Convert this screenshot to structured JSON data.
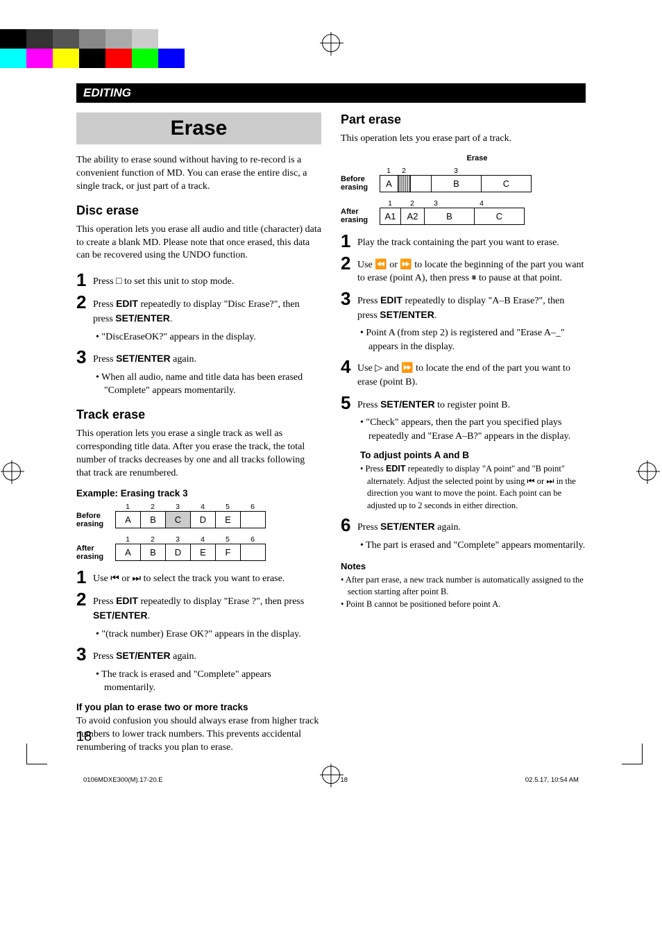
{
  "section_bar": "EDITING",
  "title": "Erase",
  "intro": "The ability to erase sound without having to re-record is a convenient function of MD. You can erase the entire disc, a single track, or just part of a track.",
  "disc_erase": {
    "heading": "Disc erase",
    "intro": "This operation lets you erase all audio and title (character) data to create a blank MD. Please note that once erased, this data can be recovered using the UNDO function.",
    "step1": "Press □ to set this unit to stop mode.",
    "step2_a": "Press ",
    "step2_edit": "EDIT",
    "step2_b": " repeatedly to display \"Disc Erase?\", then press ",
    "step2_set": "SET/ENTER",
    "step2_c": ".",
    "step2_bullet": "\"DiscEraseOK?\" appears in the display.",
    "step3_a": "Press ",
    "step3_set": "SET/ENTER",
    "step3_b": " again.",
    "step3_bullet": "When all audio, name and title data has been erased \"Complete\" appears momentarily."
  },
  "track_erase": {
    "heading": "Track erase",
    "intro": "This operation lets you erase a single track as well as corresponding title data. After you erase the track, the total number of tracks decreases by one and all tracks following that track are renumbered.",
    "example_heading": "Example: Erasing track 3",
    "before_label": "Before erasing",
    "after_label": "After erasing",
    "before_nums": [
      "1",
      "2",
      "3",
      "4",
      "5",
      "6"
    ],
    "before_cells": [
      "A",
      "B",
      "C",
      "D",
      "E",
      ""
    ],
    "after_nums": [
      "1",
      "2",
      "3",
      "4",
      "5",
      "6"
    ],
    "after_cells": [
      "A",
      "B",
      "D",
      "E",
      "F",
      ""
    ],
    "step1": "Use ⏮ or ⏭ to select the track you want to erase.",
    "step2_a": "Press ",
    "step2_edit": "EDIT",
    "step2_b": " repeatedly to display \"Erase ?\", then press ",
    "step2_set": "SET/ENTER",
    "step2_c": ".",
    "step2_bullet": "\"(track number) Erase OK?\" appears in the display.",
    "step3_a": "Press ",
    "step3_set": "SET/ENTER",
    "step3_b": " again.",
    "step3_bullet": "The track is erased and \"Complete\" appears momentarily.",
    "two_or_more_heading": "If you plan to erase two or more tracks",
    "two_or_more_body": "To avoid confusion you should always erase from higher track numbers to lower track numbers. This prevents accidental renumbering of tracks you plan to erase."
  },
  "part_erase": {
    "heading": "Part erase",
    "intro": "This operation lets you erase part of a track.",
    "erase_label": "Erase",
    "before_label": "Before erasing",
    "after_label": "After erasing",
    "before_nums": [
      "1",
      "2",
      "3"
    ],
    "before_cells": [
      "A",
      "B",
      "C"
    ],
    "after_nums": [
      "1",
      "2",
      "3",
      "4"
    ],
    "after_cells": [
      "A1",
      "A2",
      "B",
      "C"
    ],
    "step1": "Play the track containing the part you want to erase.",
    "step2": "Use ⏪ or ⏩ to locate the beginning of the part you want to erase (point A), then press ⏸ to pause at that point.",
    "step3_a": "Press ",
    "step3_edit": "EDIT",
    "step3_b": " repeatedly to display \"A–B Erase?\", then press ",
    "step3_set": "SET/ENTER",
    "step3_c": ".",
    "step3_bullet": "Point A (from step 2) is registered and \"Erase A–_\" appears in the display.",
    "step4": "Use ▷ and ⏩ to locate the end of the part you want to erase (point B).",
    "step5_a": "Press ",
    "step5_set": "SET/ENTER",
    "step5_b": " to register point B.",
    "step5_bullet": "\"Check\" appears, then the part you specified plays repeatedly and \"Erase A–B?\" appears in the display.",
    "adjust_heading": "To adjust points A and B",
    "adjust_a": "Press ",
    "adjust_edit": "EDIT",
    "adjust_b": " repeatedly to display \"A point\" and \"B point\" alternately. Adjust the selected point by using ⏮ or ⏭ in the direction you want to move the point. Each point can be adjusted up to 2 seconds in either direction.",
    "step6_a": "Press ",
    "step6_set": "SET/ENTER",
    "step6_b": " again.",
    "step6_bullet": "The part is erased and \"Complete\" appears momentarily.",
    "notes_heading": "Notes",
    "note1": "After part erase, a new track number is automatically assigned to the section starting after point B.",
    "note2": "Point B cannot be positioned before point A."
  },
  "page_number": "18",
  "footer_left": "0106MDXE300(M).17-20.E",
  "footer_center": "18",
  "footer_right": "02.5.17, 10:54 AM"
}
